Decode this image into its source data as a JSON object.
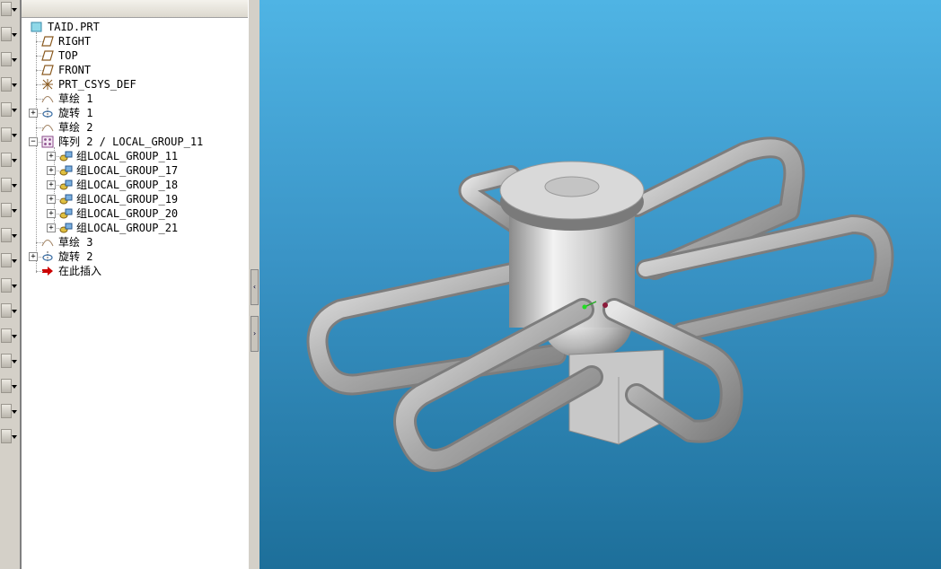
{
  "model_tree": {
    "items": [
      {
        "label": "TAID.PRT",
        "icon": "part-icon",
        "indent": 0,
        "expander": ""
      },
      {
        "label": "RIGHT",
        "icon": "datum-plane-icon",
        "indent": 1,
        "expander": ""
      },
      {
        "label": "TOP",
        "icon": "datum-plane-icon",
        "indent": 1,
        "expander": ""
      },
      {
        "label": "FRONT",
        "icon": "datum-plane-icon",
        "indent": 1,
        "expander": ""
      },
      {
        "label": "PRT_CSYS_DEF",
        "icon": "csys-icon",
        "indent": 1,
        "expander": ""
      },
      {
        "label": "草绘 1",
        "icon": "sketch-icon",
        "indent": 1,
        "expander": ""
      },
      {
        "label": "旋转 1",
        "icon": "revolve-icon",
        "indent": 1,
        "expander": "+"
      },
      {
        "label": "草绘 2",
        "icon": "sketch-icon",
        "indent": 1,
        "expander": ""
      },
      {
        "label": "阵列 2 / LOCAL_GROUP_11",
        "icon": "pattern-icon",
        "indent": 1,
        "expander": "-"
      },
      {
        "label": "组LOCAL_GROUP_11",
        "icon": "group-icon",
        "indent": 2,
        "expander": "+"
      },
      {
        "label": "组LOCAL_GROUP_17",
        "icon": "group-icon",
        "indent": 2,
        "expander": "+"
      },
      {
        "label": "组LOCAL_GROUP_18",
        "icon": "group-icon",
        "indent": 2,
        "expander": "+"
      },
      {
        "label": "组LOCAL_GROUP_19",
        "icon": "group-icon",
        "indent": 2,
        "expander": "+"
      },
      {
        "label": "组LOCAL_GROUP_20",
        "icon": "group-icon",
        "indent": 2,
        "expander": "+"
      },
      {
        "label": "组LOCAL_GROUP_21",
        "icon": "group-icon",
        "indent": 2,
        "expander": "+"
      },
      {
        "label": "草绘 3",
        "icon": "sketch-icon",
        "indent": 1,
        "expander": ""
      },
      {
        "label": "旋转 2",
        "icon": "revolve-icon",
        "indent": 1,
        "expander": "+"
      },
      {
        "label": "在此插入",
        "icon": "insert-here-arrow-icon",
        "indent": 1,
        "expander": ""
      }
    ]
  },
  "colors": {
    "viewport_top": "#4fb4e4",
    "viewport_bottom": "#1d6f9a",
    "model_gray": "#bdbdbd",
    "insert_arrow": "#cc0000"
  }
}
